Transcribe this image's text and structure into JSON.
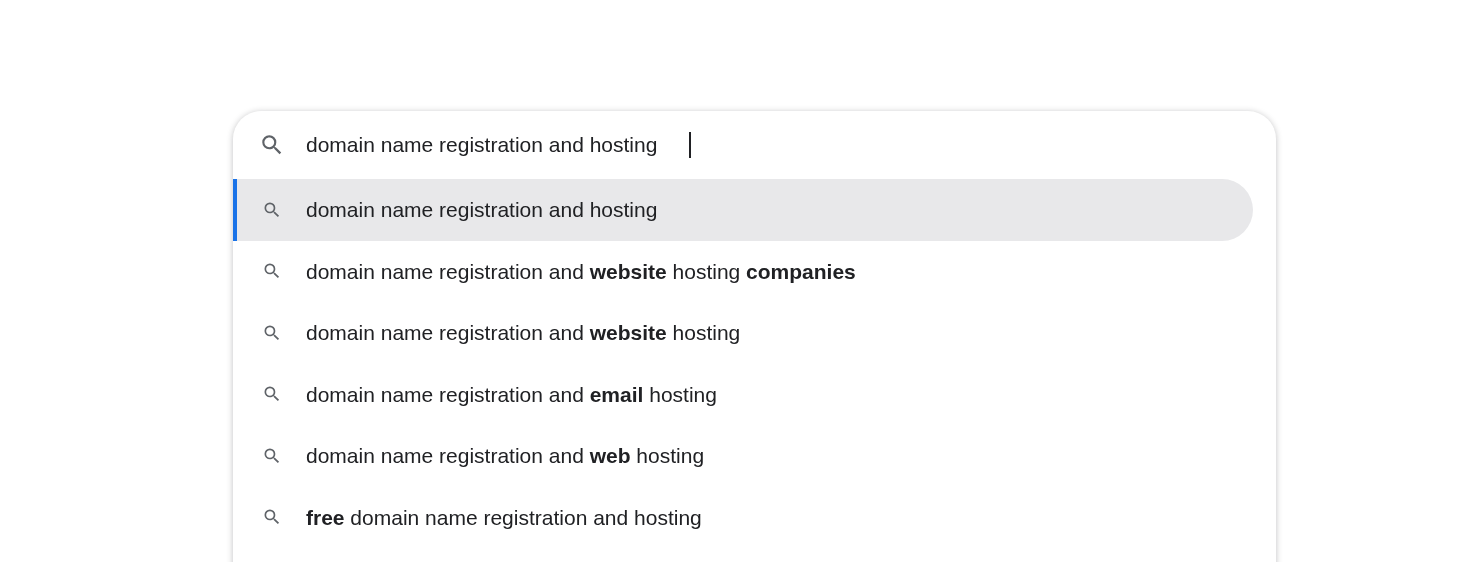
{
  "search": {
    "value": "domain name registration and hosting"
  },
  "suggestions": [
    {
      "text": "domain name registration and hosting",
      "selected": true
    },
    {
      "text": "domain name registration and **website** hosting **companies**",
      "selected": false
    },
    {
      "text": "domain name registration and **website** hosting",
      "selected": false
    },
    {
      "text": "domain name registration and **email** hosting",
      "selected": false
    },
    {
      "text": "domain name registration and **web** hosting",
      "selected": false
    },
    {
      "text": "**free** domain name registration and hosting",
      "selected": false
    }
  ]
}
